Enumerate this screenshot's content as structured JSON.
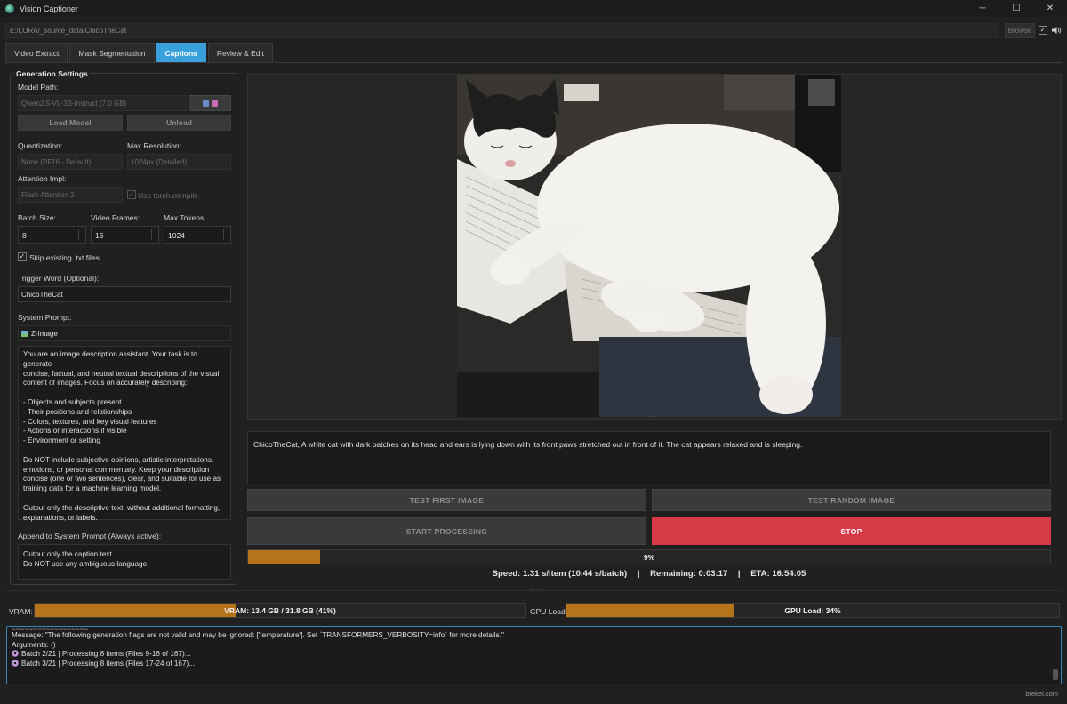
{
  "app": {
    "title": "Vision Captioner",
    "icon": "app-logo-icon"
  },
  "window_controls": {
    "minimize": "─",
    "maximize": "☐",
    "close": "✕"
  },
  "path_bar": {
    "value": "E:/LORA/_source_data/ChicoTheCat",
    "browse_label": "Browse",
    "checkbox_checked": true,
    "speaker_icon": "speaker-icon"
  },
  "tabs": [
    {
      "label": "Video Extract",
      "active": false
    },
    {
      "label": "Mask Segmentation",
      "active": false
    },
    {
      "label": "Captions",
      "active": true
    },
    {
      "label": "Review & Edit",
      "active": false
    }
  ],
  "settings": {
    "group_title": "Generation Settings",
    "model_path_label": "Model Path:",
    "model_path_value": "Qwen2.5-VL-3B-Instruct (7.0 GB)",
    "load_model_label": "Load Model",
    "unload_label": "Unload",
    "quantization_label": "Quantization:",
    "quantization_value": "None (BF16 - Default)",
    "max_resolution_label": "Max Resolution:",
    "max_resolution_value": "1024px (Detailed)",
    "attention_label": "Attention Impl:",
    "attention_value": "Flash Attention 2",
    "torch_compile_label": "Use torch.compile",
    "batch_size_label": "Batch Size:",
    "batch_size_value": "8",
    "video_frames_label": "Video Frames:",
    "video_frames_value": "16",
    "max_tokens_label": "Max Tokens:",
    "max_tokens_value": "1024",
    "skip_existing_label": "Skip existing .txt files",
    "skip_existing_checked": true,
    "trigger_word_label": "Trigger Word (Optional):",
    "trigger_word_value": "ChicoTheCat",
    "system_prompt_label": "System Prompt:",
    "system_prompt_preset": "Z-Image",
    "system_prompt_lines": [
      "You are an image description assistant. Your task is to generate",
      "concise, factual, and neutral textual descriptions of the visual",
      "content of images. Focus on accurately describing:",
      "",
      "- Objects and subjects present",
      "- Their positions and relationships",
      "- Colors, textures, and key visual features",
      "- Actions or interactions if visible",
      "- Environment or setting",
      "",
      "Do NOT include subjective opinions, artistic interpretations,",
      "emotions, or personal commentary. Keep your description",
      "concise (one or two sentences), clear, and suitable for use as",
      "training data for a machine learning model.",
      "",
      "Output only the descriptive text, without additional formatting,",
      "explanations, or labels."
    ],
    "append_label": "Append to System Prompt (Always active):",
    "append_lines": [
      "Output only the caption text.",
      "Do NOT use any ambiguous language."
    ]
  },
  "preview": {
    "caption": "ChicoTheCat, A white cat with dark patches on its head and ears is lying down with its front paws stretched out in front of it. The cat appears relaxed and is sleeping."
  },
  "actions": {
    "test_first": "TEST FIRST IMAGE",
    "test_random": "TEST RANDOM IMAGE",
    "start": "START PROCESSING",
    "stop": "STOP"
  },
  "progress": {
    "value": 0.09,
    "label": "9%"
  },
  "stats": {
    "speed": "Speed: 1.31 s/item (10.44 s/batch)",
    "remaining": "Remaining: 0:03:17",
    "eta": "ETA: 16:54:05",
    "separator": "|"
  },
  "usage": {
    "vram_label": "VRAM:",
    "vram_text": "VRAM: 13.4 GB / 31.8 GB (41%)",
    "vram_fraction": 0.41,
    "gpu_label": "GPU Load:",
    "gpu_text": "GPU Load: 34%",
    "gpu_fraction": 0.34
  },
  "log": {
    "lines": [
      "Message: \"The following generation flags are not valid and may be ignored: ['temperature']. Set `TRANSFORMERS_VERBOSITY=info` for more details.\"",
      "Arguments: ()",
      "Batch 2/21 | Processing 8 items (Files 9-16 of 167)...",
      "Batch 3/21 | Processing 8 items (Files 17-24 of 167)..."
    ]
  },
  "credit": "brekel.com",
  "colors": {
    "accent": "#3aa0dc",
    "progress": "#b5731a",
    "stop": "#d63a47",
    "background": "#202020"
  }
}
